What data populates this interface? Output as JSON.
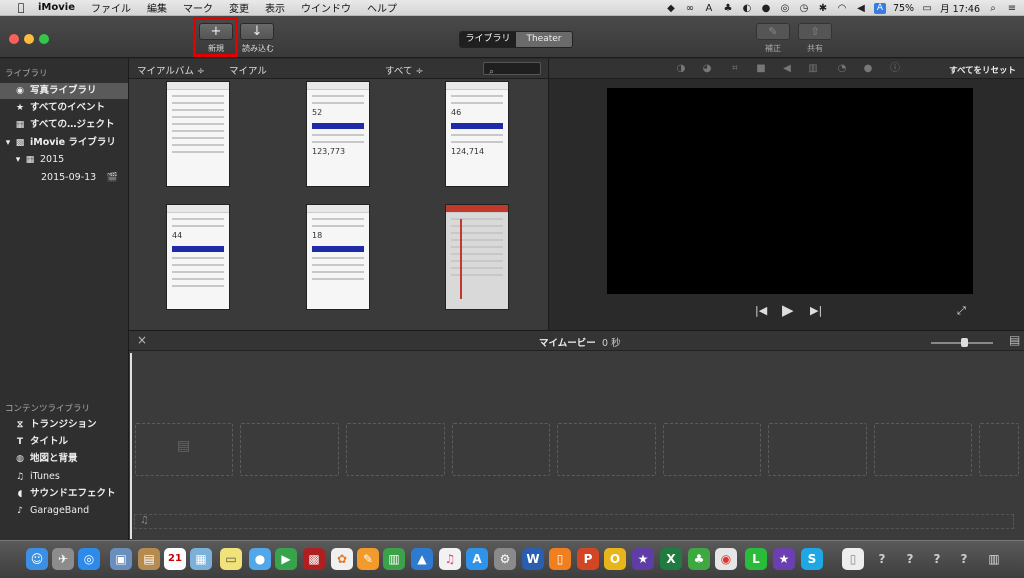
{
  "menubar": {
    "apple": "",
    "app_name": "iMovie",
    "menus": [
      "ファイル",
      "編集",
      "マーク",
      "変更",
      "表示",
      "ウインドウ",
      "ヘルプ"
    ],
    "battery": "75%",
    "clock": "月 17:46",
    "input_source": "A"
  },
  "toolbar": {
    "new_label": "新規",
    "import_label": "読み込む",
    "tabs": [
      "ライブラリ",
      "Theater"
    ],
    "adjust_label": "補正",
    "share_label": "共有"
  },
  "sidebar": {
    "library_header": "ライブラリ",
    "items": [
      {
        "label": "写真ライブラリ",
        "icon": "photos-icon"
      },
      {
        "label": "すべてのイベント",
        "icon": "star-icon"
      },
      {
        "label": "すべての…ジェクト",
        "icon": "film-icon"
      },
      {
        "label": "iMovie ライブラリ",
        "icon": "grid-icon"
      },
      {
        "label": "2015",
        "icon": "calendar-icon"
      },
      {
        "label": "2015-09-13",
        "icon": "clapper-icon"
      }
    ],
    "content_header": "コンテンツライブラリ",
    "content_items": [
      {
        "label": "トランジション",
        "icon": "transition-icon"
      },
      {
        "label": "タイトル",
        "icon": "title-icon"
      },
      {
        "label": "地図と背景",
        "icon": "globe-icon"
      },
      {
        "label": "iTunes",
        "icon": "music-icon"
      },
      {
        "label": "サウンドエフェクト",
        "icon": "sound-icon"
      },
      {
        "label": "GarageBand",
        "icon": "guitar-icon"
      }
    ]
  },
  "browser": {
    "album": "マイアルバム ÷",
    "subalbum": "マイアル",
    "filter": "すべて ÷",
    "thumb_values": [
      "",
      "52",
      "46",
      "44",
      "18",
      ""
    ],
    "thumb_totals": [
      "",
      "123,773",
      "124,714",
      "",
      "",
      ""
    ]
  },
  "viewer": {
    "reset_all": "すべてをリセット"
  },
  "timeline": {
    "title": "マイムービー",
    "duration": "0 秒"
  }
}
